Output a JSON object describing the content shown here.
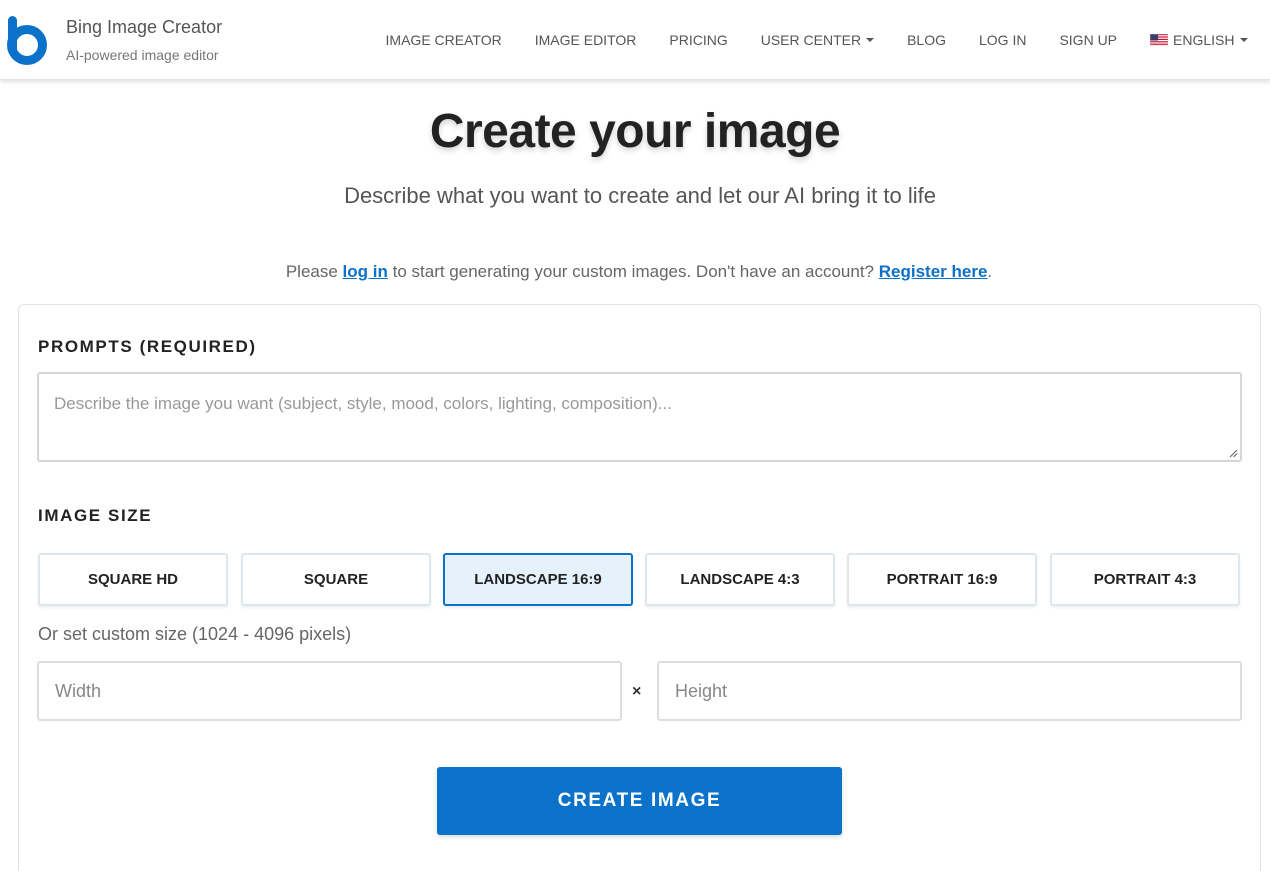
{
  "brand": {
    "title": "Bing Image Creator",
    "subtitle": "AI-powered image editor",
    "logo_icon": "bing-b-logo",
    "accent_color": "#0b72c9"
  },
  "nav": {
    "items": [
      {
        "label": "IMAGE CREATOR"
      },
      {
        "label": "IMAGE EDITOR"
      },
      {
        "label": "PRICING"
      },
      {
        "label": "USER CENTER",
        "dropdown": true
      },
      {
        "label": "BLOG"
      },
      {
        "label": "LOG IN"
      },
      {
        "label": "SIGN UP"
      }
    ],
    "language": {
      "label": "ENGLISH",
      "icon": "us-flag-icon",
      "dropdown": true
    }
  },
  "hero": {
    "title": "Create your image",
    "subtitle": "Describe what you want to create and let our AI bring it to life"
  },
  "login_notice": {
    "prefix": "Please",
    "login_link": "log in",
    "middle": "to start generating your custom images. Don't have an account?",
    "register_link": "Register here",
    "suffix": "."
  },
  "form": {
    "prompt_label": "PROMPTS (REQUIRED)",
    "prompt_placeholder": "Describe the image you want (subject, style, mood, colors, lighting, composition)...",
    "prompt_value": "",
    "size_label": "IMAGE SIZE",
    "sizes": [
      {
        "label": "SQUARE HD",
        "selected": false
      },
      {
        "label": "SQUARE",
        "selected": false
      },
      {
        "label": "LANDSCAPE 16:9",
        "selected": true
      },
      {
        "label": "LANDSCAPE 4:3",
        "selected": false
      },
      {
        "label": "PORTRAIT 16:9",
        "selected": false
      },
      {
        "label": "PORTRAIT 4:3",
        "selected": false
      }
    ],
    "custom_note": "Or set custom size (1024 - 4096 pixels)",
    "width_placeholder": "Width",
    "height_placeholder": "Height",
    "times_symbol": "×",
    "submit_label": "CREATE IMAGE"
  }
}
